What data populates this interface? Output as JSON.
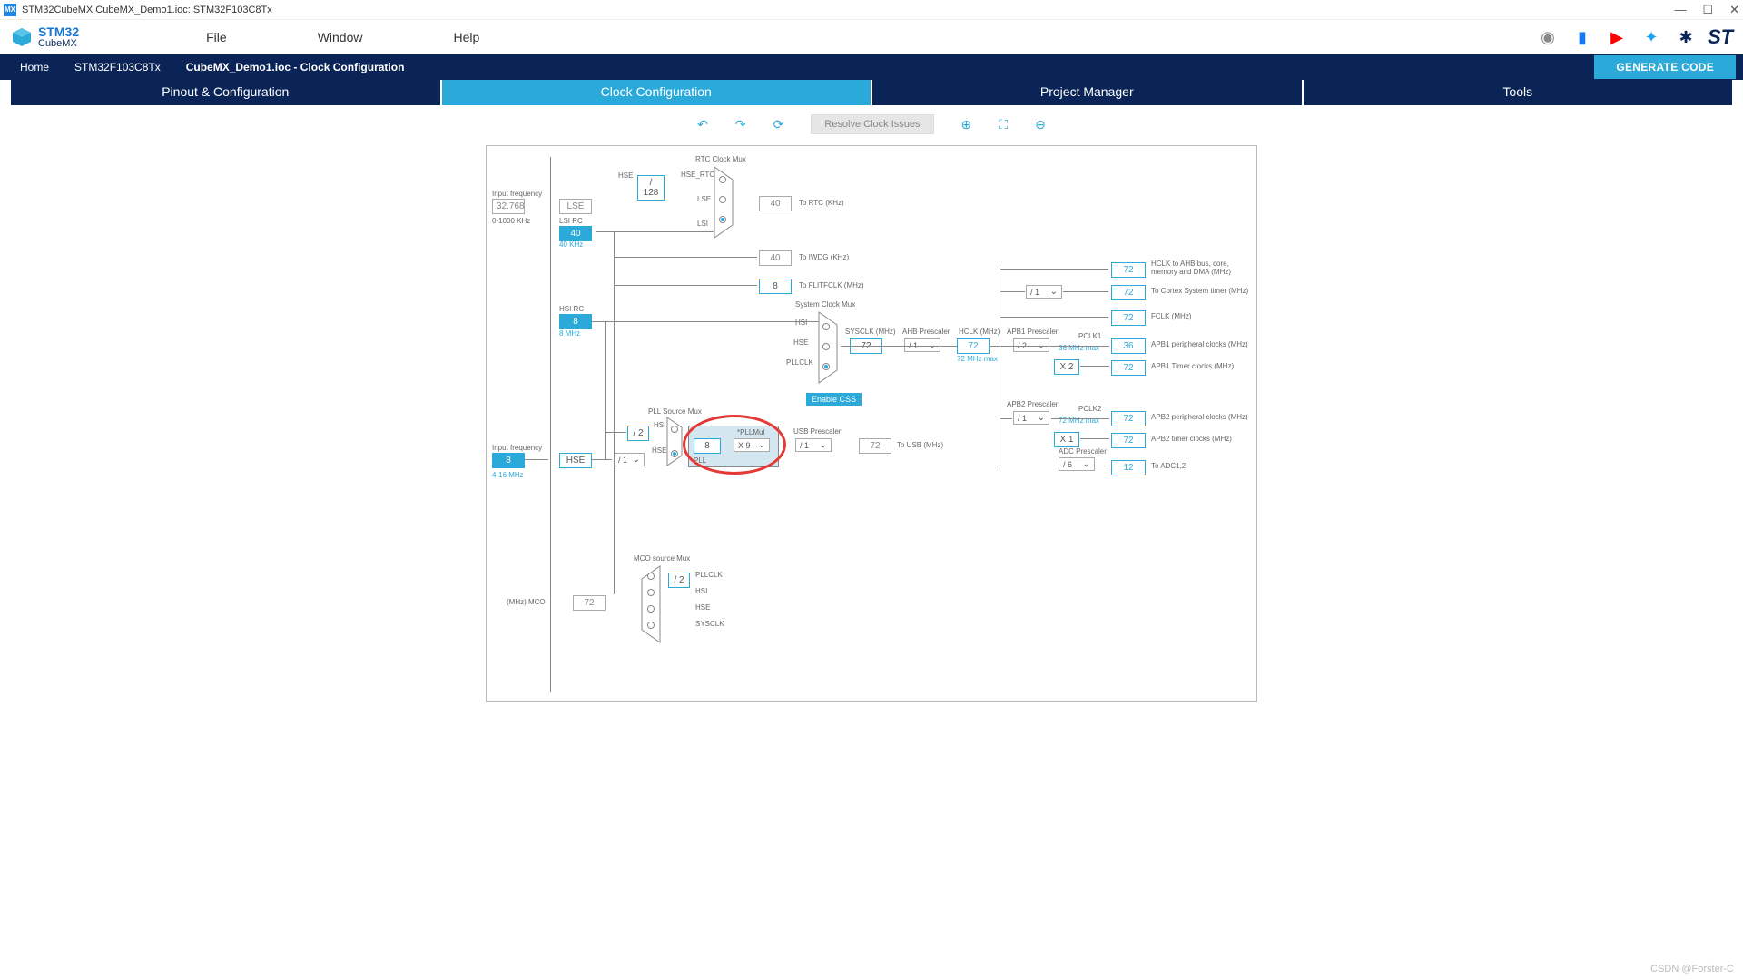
{
  "title": "STM32CubeMX CubeMX_Demo1.ioc: STM32F103C8Tx",
  "logo": {
    "line1": "STM32",
    "line2": "CubeMX"
  },
  "menu": {
    "file": "File",
    "window": "Window",
    "help": "Help"
  },
  "breadcrumbs": {
    "home": "Home",
    "chip": "STM32F103C8Tx",
    "file": "CubeMX_Demo1.ioc - Clock Configuration"
  },
  "generate": "GENERATE CODE",
  "tabs": {
    "pinout": "Pinout & Configuration",
    "clock": "Clock Configuration",
    "project": "Project Manager",
    "tools": "Tools"
  },
  "toolbar": {
    "resolve": "Resolve Clock Issues"
  },
  "diagram": {
    "input_freq_lse": "Input frequency",
    "lse_val": "32.768",
    "lse_range": "0-1000 KHz",
    "lse": "LSE",
    "lsirc": "LSI RC",
    "lsi_val": "40",
    "lsi_hz": "40 KHz",
    "hsi_rc": "HSI RC",
    "hsi_val": "8",
    "hsi_hz": "8 MHz",
    "input_freq_hse": "Input frequency",
    "hse_val_in": "8",
    "hse_range": "4-16 MHz",
    "hse": "HSE",
    "hse_div": "/ 1",
    "div128": "/ 128",
    "rtc_mux": "RTC Clock Mux",
    "hse_rtc": "HSE_RTC",
    "lse_l": "LSE",
    "lsi_l": "LSI",
    "to_rtc": "To RTC (KHz)",
    "rtc_val": "40",
    "to_iwdg": "To IWDG (KHz)",
    "iwdg_val": "40",
    "to_flit": "To FLITFCLK (MHz)",
    "flit_val": "8",
    "sys_mux": "System Clock Mux",
    "hsi_l": "HSI",
    "hse_l2": "HSE",
    "pllclk": "PLLCLK",
    "css_btn": "Enable CSS",
    "sysclk_lbl": "SYSCLK (MHz)",
    "sysclk_val": "72",
    "ahb_pre": "AHB Prescaler",
    "ahb_div": "/ 1",
    "hclk_lbl": "HCLK (MHz)",
    "hclk_val": "72",
    "hclk_max": "72 MHz max",
    "pll_src": "PLL Source Mux",
    "div2": "/ 2",
    "hsi_l2": "HSI",
    "hse_l3": "HSE",
    "pll_in": "8",
    "pllmul_lbl": "*PLLMul",
    "pllmul_sel": "X 9",
    "pll_lbl": "PLL",
    "usb_pre": "USB Prescaler",
    "usb_div": "/ 1",
    "usb_val": "72",
    "to_usb": "To USB (MHz)",
    "mco_src": "MCO source Mux",
    "mco_div2": "/ 2",
    "mco_pllclk": "PLLCLK",
    "mco_hsi": "HSI",
    "mco_hse": "HSE",
    "mco_sysclk": "SYSCLK",
    "mco_val": "72",
    "mco_lbl": "(MHz) MCO",
    "apb1_pre": "APB1 Prescaler",
    "apb1_div": "/ 2",
    "apb1_max": "36 MHz max",
    "pclk1": "PCLK1",
    "x2": "X 2",
    "apb2_pre": "APB2 Prescaler",
    "apb2_div": "/ 1",
    "apb2_max": "72 MHz max",
    "pclk2": "PCLK2",
    "x1": "X 1",
    "adc_pre": "ADC Prescaler",
    "adc_div": "/ 6",
    "ahb_div2": "/ 1",
    "out_hclk_ahb": "72",
    "out_hclk_ahb_l": "HCLK to AHB bus, core, memory and DMA (MHz)",
    "out_cortex": "72",
    "out_cortex_l": "To Cortex System timer (MHz)",
    "out_fclk": "72",
    "out_fclk_l": "FCLK (MHz)",
    "out_apb1_p": "36",
    "out_apb1_p_l": "APB1 peripheral clocks (MHz)",
    "out_apb1_t": "72",
    "out_apb1_t_l": "APB1 Timer clocks (MHz)",
    "out_apb2_p": "72",
    "out_apb2_p_l": "APB2 peripheral clocks (MHz)",
    "out_apb2_t": "72",
    "out_apb2_t_l": "APB2 timer clocks (MHz)",
    "out_adc": "12",
    "out_adc_l": "To ADC1,2"
  },
  "watermark": "CSDN @Forster-C"
}
